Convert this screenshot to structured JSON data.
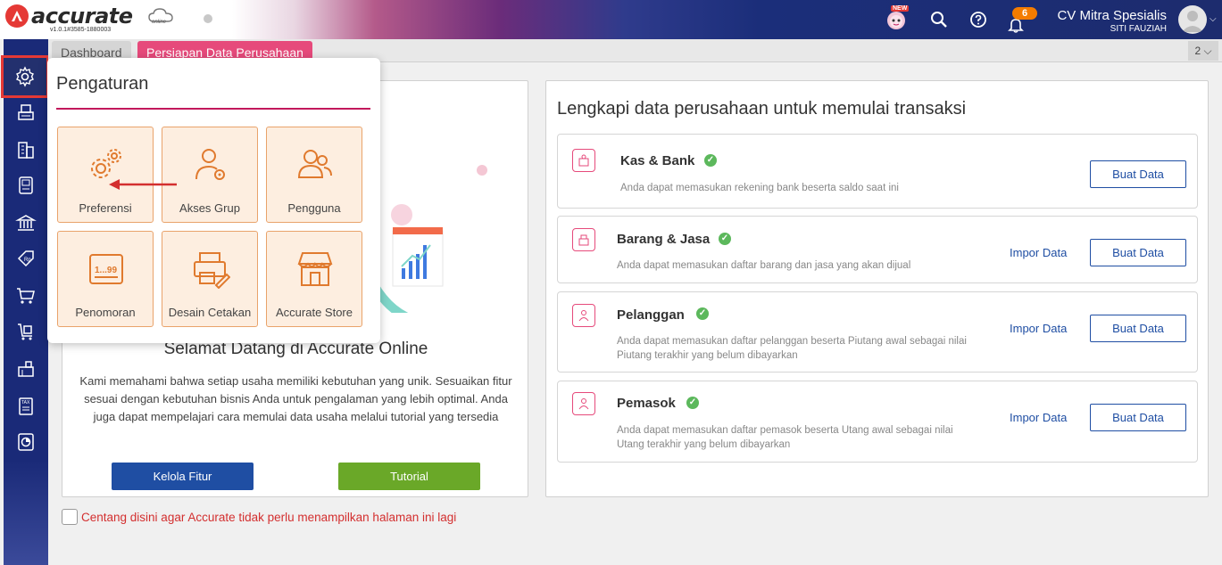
{
  "app": {
    "logo_text": "accurate",
    "logo_sub": "online",
    "version": "v1.0.1#3585-1880003",
    "new_badge": "NEW",
    "notification_count": "6",
    "company_name": "CV Mitra Spesialis",
    "user_name": "SITI FAUZIAH"
  },
  "tabs": {
    "dashboard": "Dashboard",
    "persiapan": "Persiapan Data Perusahaan",
    "counter": "2 ⌵"
  },
  "popup": {
    "title": "Pengaturan",
    "tiles": [
      {
        "label": "Preferensi",
        "icon": "gears-icon"
      },
      {
        "label": "Akses Grup",
        "icon": "user-key-icon"
      },
      {
        "label": "Pengguna",
        "icon": "users-icon"
      },
      {
        "label": "Penomoran",
        "icon": "numbering-icon"
      },
      {
        "label": "Desain Cetakan",
        "icon": "print-design-icon"
      },
      {
        "label": "Accurate Store",
        "icon": "store-icon"
      }
    ]
  },
  "welcome": {
    "title": "Selamat Datang di Accurate Online",
    "text": "Kami memahami bahwa setiap usaha memiliki kebutuhan yang unik. Sesuaikan fitur sesuai dengan kebutuhan bisnis Anda untuk pengalaman yang lebih optimal. Anda juga dapat mempelajari cara memulai data usaha melalui tutorial yang tersedia",
    "kelola_label": "Kelola Fitur",
    "tutorial_label": "Tutorial"
  },
  "right": {
    "title": "Lengkapi data perusahaan untuk memulai transaksi",
    "impor_label": "Impor Data",
    "buat_label": "Buat Data",
    "cards": [
      {
        "title": "Kas & Bank",
        "desc": "Anda dapat memasukan rekening bank beserta saldo saat ini"
      },
      {
        "title": "Barang & Jasa",
        "desc": "Anda dapat memasukan daftar barang dan jasa yang akan dijual"
      },
      {
        "title": "Pelanggan",
        "desc": "Anda dapat memasukan daftar pelanggan beserta Piutang awal sebagai nilai Piutang terakhir yang belum dibayarkan"
      },
      {
        "title": "Pemasok",
        "desc": "Anda dapat memasukan daftar pemasok beserta Utang awal sebagai nilai Utang terakhir yang belum dibayarkan"
      }
    ]
  },
  "footer": {
    "checkbox_label": "Centang disini agar Accurate tidak perlu menampilkan halaman ini lagi"
  },
  "colors": {
    "brand_red": "#e53935",
    "accent_pink": "#e64a7b",
    "primary_blue": "#1f4ea3",
    "success_green": "#6aa828",
    "sidebar_navy": "#1a2a78"
  }
}
